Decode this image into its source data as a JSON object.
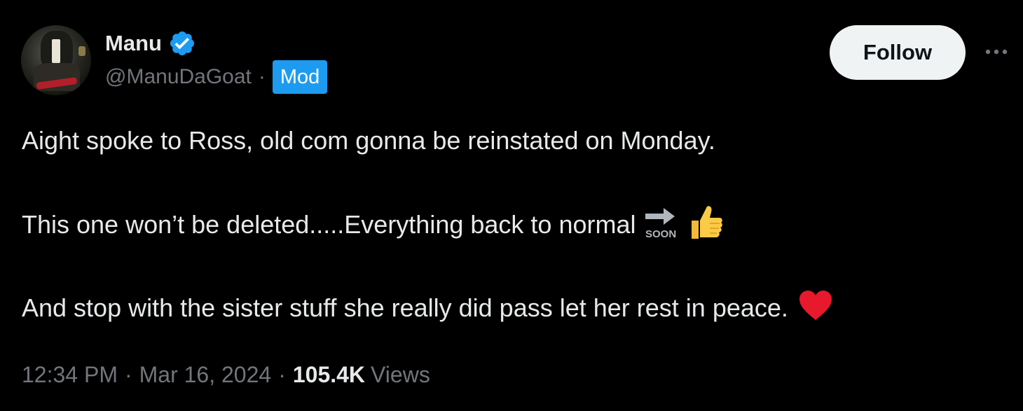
{
  "author": {
    "display_name": "Manu",
    "handle": "@ManuDaGoat",
    "separator": "·",
    "badge": "Mod",
    "verified": true,
    "avatar_icon": "profile-photo"
  },
  "actions": {
    "follow_label": "Follow",
    "more_icon": "more-horizontal-icon"
  },
  "tweet": {
    "line1": "Aight spoke to Ross, old com gonna be reinstated on Monday.",
    "line2": "This one won’t be deleted.....Everything back to normal",
    "line2_emoji": [
      "soon-arrow-icon",
      "thumbs-up-icon"
    ],
    "soon_label": "SOON",
    "line3": "And stop with the sister stuff she really did pass let her rest in peace.",
    "line3_emoji": [
      "red-heart-icon"
    ]
  },
  "meta": {
    "time": "12:34 PM",
    "sep1": "·",
    "date": "Mar 16, 2024",
    "sep2": "·",
    "views_count": "105.4K",
    "views_label": "Views"
  },
  "colors": {
    "background": "#000000",
    "text_primary": "#e7e9ea",
    "text_secondary": "#71767b",
    "accent_blue": "#1d9bf0",
    "follow_bg": "#eff3f4",
    "heart": "#e8192c"
  }
}
